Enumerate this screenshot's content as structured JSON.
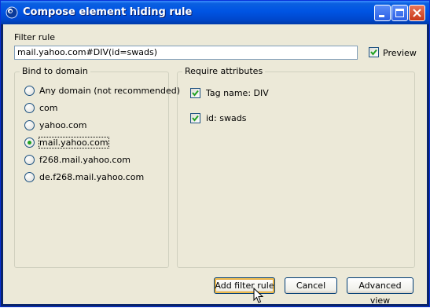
{
  "window": {
    "title": "Compose element hiding rule"
  },
  "filter": {
    "label": "Filter rule",
    "value": "mail.yahoo.com#DIV(id=swads)",
    "preview_label": "Preview",
    "preview_checked": true
  },
  "domain_group": {
    "title": "Bind to domain",
    "options": [
      {
        "label": "Any domain (not recommended)",
        "selected": false
      },
      {
        "label": "com",
        "selected": false
      },
      {
        "label": "yahoo.com",
        "selected": false
      },
      {
        "label": "mail.yahoo.com",
        "selected": true
      },
      {
        "label": "f268.mail.yahoo.com",
        "selected": false
      },
      {
        "label": "de.f268.mail.yahoo.com",
        "selected": false
      }
    ]
  },
  "attributes_group": {
    "title": "Require attributes",
    "items": [
      {
        "label": "Tag name: DIV",
        "checked": true
      },
      {
        "label": "id: swads",
        "checked": true
      }
    ]
  },
  "buttons": {
    "add": "Add filter rule",
    "cancel": "Cancel",
    "advanced": "Advanced view"
  }
}
